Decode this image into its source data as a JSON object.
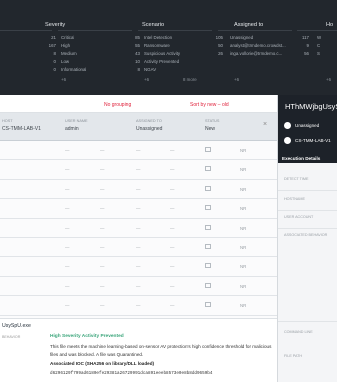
{
  "filters": {
    "severity": {
      "heading": "Severity",
      "items": [
        {
          "count": "21",
          "label": "Critical"
        },
        {
          "count": "167",
          "label": "High"
        },
        {
          "count": "8",
          "label": "Medium"
        },
        {
          "count": "0",
          "label": "Low"
        },
        {
          "count": "0",
          "label": "Informational"
        }
      ],
      "more": "+6"
    },
    "scenario": {
      "heading": "Scenario",
      "items": [
        {
          "label": "Intel Detection",
          "count": "85"
        },
        {
          "label": "Ransomware",
          "count": "55"
        },
        {
          "label": "Suspicious Activity",
          "count": "43"
        },
        {
          "label": "Activity Prevented",
          "count": "10"
        },
        {
          "label": "NGAV",
          "count": "8"
        }
      ],
      "more": "+6",
      "more_right": "8 more"
    },
    "assigned": {
      "heading": "Assigned to",
      "items": [
        {
          "count": "105",
          "label": "Unassigned"
        },
        {
          "count": "50",
          "label": "analyst@trmdemo.crowdst..."
        },
        {
          "count": "26",
          "label": "inga.vollorie@trmdemo.c..."
        }
      ],
      "more": "+6"
    },
    "hosts": {
      "heading": "Ho",
      "items": [
        {
          "count": "117",
          "label": "W"
        },
        {
          "count": "9",
          "label": "C"
        },
        {
          "count": "56",
          "label": "S"
        }
      ],
      "more": "+6"
    }
  },
  "toolbar": {
    "grouping": "No grouping",
    "sort": "Sort by new – old"
  },
  "header": {
    "host_label": "HOST",
    "host_value": "CS-TMM-LAB-V1",
    "user_label": "USER NAME",
    "user_value": "admin",
    "assigned_label": "ASSIGNED TO",
    "assigned_value": "Unassigned",
    "status_label": "STATUS",
    "status_value": "New",
    "close": "×"
  },
  "rows": [
    {
      "a": "—",
      "b": "—",
      "c": "—",
      "d": "—",
      "e": "NR"
    },
    {
      "a": "—",
      "b": "—",
      "c": "—",
      "d": "—",
      "e": "NR"
    },
    {
      "a": "—",
      "b": "—",
      "c": "—",
      "d": "—",
      "e": "NR"
    },
    {
      "a": "—",
      "b": "—",
      "c": "—",
      "d": "—",
      "e": "NR"
    },
    {
      "a": "—",
      "b": "—",
      "c": "—",
      "d": "—",
      "e": "NR"
    },
    {
      "a": "—",
      "b": "—",
      "c": "—",
      "d": "—",
      "e": "NR"
    },
    {
      "a": "—",
      "b": "—",
      "c": "—",
      "d": "—",
      "e": "NR"
    },
    {
      "a": "—",
      "b": "—",
      "c": "—",
      "d": "—",
      "e": "NR"
    },
    {
      "a": "—",
      "b": "—",
      "c": "—",
      "d": "—",
      "e": "NR"
    },
    {
      "a": "—",
      "b": "—",
      "c": "—",
      "d": "—",
      "e": "NR"
    }
  ],
  "detail": {
    "filename": "UsySpU.exe",
    "label": "BEHAVIOR",
    "activity": "High Severity Activity Prevented",
    "description": "This file meets the machine learning-based on-sensor AV protection's high confidence threshold for malicious files and was blocked. A file was Quarantined.",
    "ioc": "Associated IOC (SHA256 on library/DLL loaded)",
    "hash": "d6296129f799ad6180efe29381a26729991dca891eeeb8573e0e8b8dd9659b4"
  },
  "side": {
    "title": "HThMWjbgUsyS",
    "assignee": "Unassigned",
    "host": "CS-TMM-LAB-V1",
    "section": "Execution Details",
    "keys": [
      "DETECT TIME",
      "HOSTNAME",
      "USER ACCOUNT",
      "ASSOCIATED BEHAVIOR",
      "COMMAND LINE",
      "FILE PATH"
    ]
  }
}
